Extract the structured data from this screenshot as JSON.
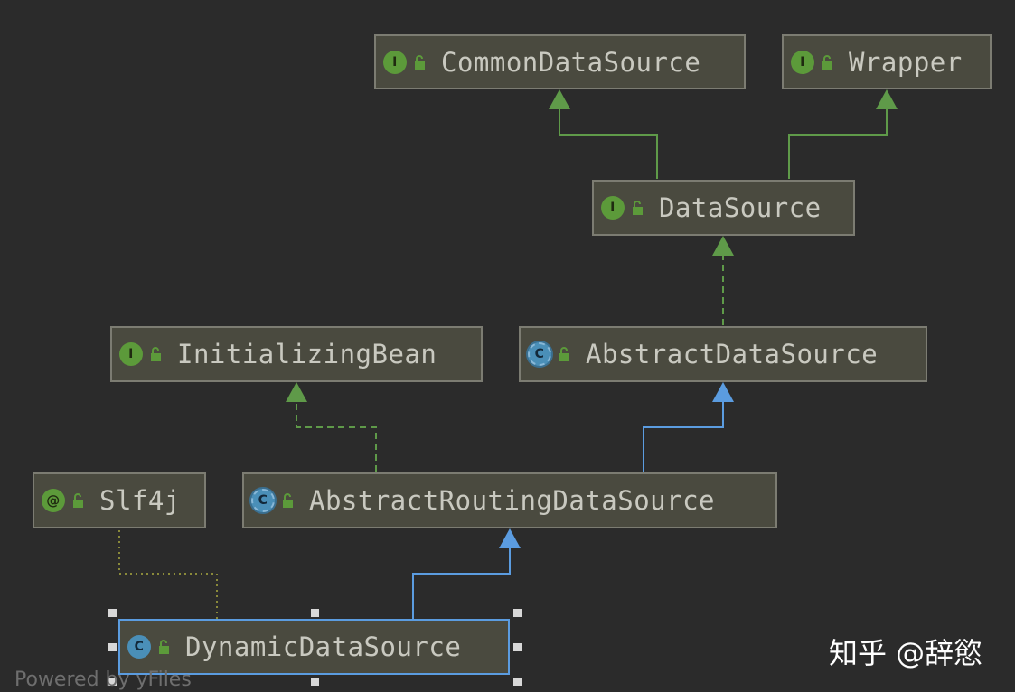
{
  "nodes": {
    "common_data_source": {
      "label": "CommonDataSource",
      "kind": "interface",
      "badge": "I"
    },
    "wrapper": {
      "label": "Wrapper",
      "kind": "interface",
      "badge": "I"
    },
    "data_source": {
      "label": "DataSource",
      "kind": "interface",
      "badge": "I"
    },
    "initializing_bean": {
      "label": "InitializingBean",
      "kind": "interface",
      "badge": "I"
    },
    "abstract_data_source": {
      "label": "AbstractDataSource",
      "kind": "abstract-class",
      "badge": "C"
    },
    "slf4j": {
      "label": "Slf4j",
      "kind": "annotation",
      "badge": "@"
    },
    "abstract_routing_data_source": {
      "label": "AbstractRoutingDataSource",
      "kind": "abstract-class",
      "badge": "C"
    },
    "dynamic_data_source": {
      "label": "DynamicDataSource",
      "kind": "class",
      "badge": "C",
      "selected": true
    }
  },
  "edges": [
    {
      "from": "DataSource",
      "to": "CommonDataSource",
      "type": "interface-extends"
    },
    {
      "from": "DataSource",
      "to": "Wrapper",
      "type": "interface-extends"
    },
    {
      "from": "AbstractDataSource",
      "to": "DataSource",
      "type": "implements"
    },
    {
      "from": "AbstractRoutingDataSource",
      "to": "InitializingBean",
      "type": "implements"
    },
    {
      "from": "AbstractRoutingDataSource",
      "to": "AbstractDataSource",
      "type": "extends"
    },
    {
      "from": "DynamicDataSource",
      "to": "AbstractRoutingDataSource",
      "type": "extends"
    },
    {
      "from": "DynamicDataSource",
      "to": "Slf4j",
      "type": "annotated-with"
    }
  ],
  "colors": {
    "background": "#2b2b2b",
    "node_fill": "#4a4a3f",
    "node_border": "#7c7c72",
    "selected_border": "#5b9ce0",
    "interface_edge": "#5f9a49",
    "class_edge": "#5b9ce0",
    "annotation_edge": "#8a8a3a",
    "interface_badge": "#5c9a3a",
    "class_badge": "#4a8fb8"
  },
  "footer": {
    "powered_by": "Powered by yFiles"
  },
  "watermark": {
    "text": "知乎 @辞慾"
  }
}
